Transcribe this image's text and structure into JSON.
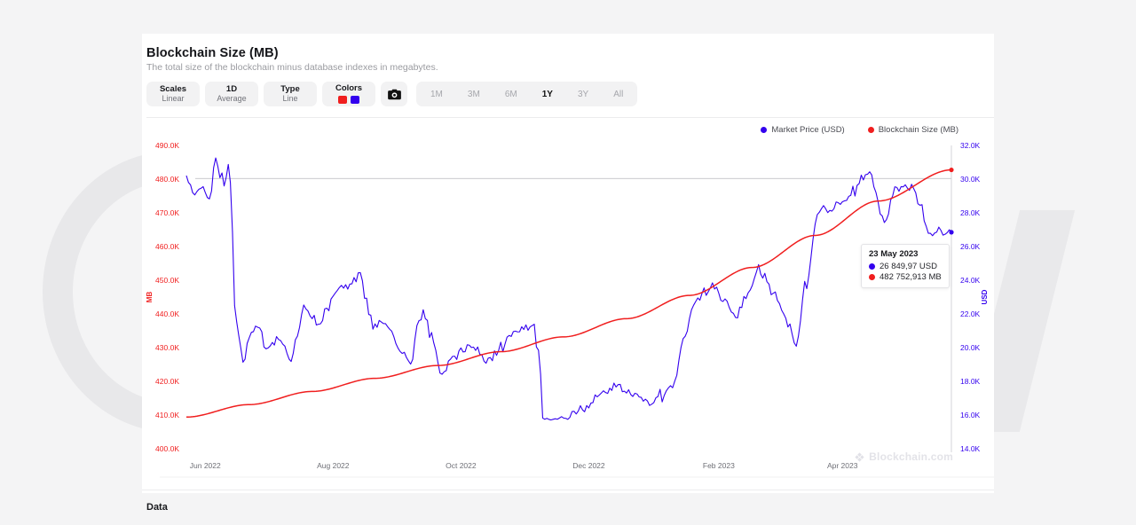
{
  "header": {
    "title": "Blockchain Size (MB)",
    "subtitle": "The total size of the blockchain minus database indexes in megabytes."
  },
  "toolbar": {
    "scales": {
      "label": "Scales",
      "value": "Linear"
    },
    "interval": {
      "label": "1D",
      "value": "Average"
    },
    "type": {
      "label": "Type",
      "value": "Line"
    },
    "colors": {
      "label": "Colors",
      "swatch_1": "#f01e1e",
      "swatch_2": "#3300ee"
    },
    "camera_icon": "camera-icon",
    "ranges": [
      "1M",
      "3M",
      "6M",
      "1Y",
      "3Y",
      "All"
    ],
    "active_range": "1Y"
  },
  "legend": [
    {
      "label": "Market Price (USD)",
      "color": "#3300ee"
    },
    {
      "label": "Blockchain Size (MB)",
      "color": "#f01e1e"
    }
  ],
  "tooltip": {
    "date": "23 May 2023",
    "rows": [
      {
        "value": "26 849,97 USD",
        "color": "#3300ee"
      },
      {
        "value": "482 752,913 MB",
        "color": "#f01e1e"
      }
    ]
  },
  "watermark": {
    "text": "Blockchain.com",
    "icon": "blockchain-logo-icon"
  },
  "footer": {
    "data_label": "Data"
  },
  "chart_data": {
    "type": "line",
    "title": "Blockchain Size (MB)",
    "subtitle": "The total size of the blockchain minus database indexes in megabytes.",
    "xlabel": "",
    "grid": false,
    "legend_position": "top-right",
    "x_tick_labels": [
      "Jun 2022",
      "Aug 2022",
      "Oct 2022",
      "Dec 2022",
      "Feb 2023",
      "Apr 2023"
    ],
    "x_range": [
      "2022-05-23",
      "2023-05-23"
    ],
    "axes": [
      {
        "id": "left",
        "name": "MB",
        "color": "#f01e1e",
        "ylim": [
          400000,
          490000
        ],
        "tick_labels": [
          "490.0K",
          "480.0K",
          "470.0K",
          "460.0K",
          "450.0K",
          "440.0K",
          "430.0K",
          "420.0K",
          "410.0K",
          "400.0K"
        ],
        "tick_values": [
          490000,
          480000,
          470000,
          460000,
          450000,
          440000,
          430000,
          420000,
          410000,
          400000
        ]
      },
      {
        "id": "right",
        "name": "USD",
        "color": "#3300ee",
        "ylim": [
          14000,
          32000
        ],
        "tick_labels": [
          "32.0K",
          "30.0K",
          "28.0K",
          "26.0K",
          "24.0K",
          "22.0K",
          "20.0K",
          "18.0K",
          "16.0K",
          "14.0K"
        ],
        "tick_values": [
          32000,
          30000,
          28000,
          26000,
          24000,
          22000,
          20000,
          18000,
          16000,
          14000
        ]
      }
    ],
    "series": [
      {
        "name": "Blockchain Size (MB)",
        "color": "#f01e1e",
        "axis": "left",
        "unit": "MB",
        "points": [
          {
            "x": "2022-05-23",
            "y": 409400
          },
          {
            "x": "2022-06-22",
            "y": 413100
          },
          {
            "x": "2022-07-22",
            "y": 417000
          },
          {
            "x": "2022-08-21",
            "y": 420900
          },
          {
            "x": "2022-09-20",
            "y": 424700
          },
          {
            "x": "2022-10-20",
            "y": 428800
          },
          {
            "x": "2022-11-19",
            "y": 433200
          },
          {
            "x": "2022-12-19",
            "y": 438600
          },
          {
            "x": "2023-01-18",
            "y": 445500
          },
          {
            "x": "2023-02-17",
            "y": 453800
          },
          {
            "x": "2023-03-19",
            "y": 463300
          },
          {
            "x": "2023-04-18",
            "y": 473500
          },
          {
            "x": "2023-05-23",
            "y": 482753
          }
        ]
      },
      {
        "name": "Market Price (USD)",
        "color": "#3300ee",
        "axis": "right",
        "unit": "USD",
        "final_value": 26849.97,
        "points": [
          {
            "x": "2022-05-23",
            "y": 30200
          },
          {
            "x": "2022-05-27",
            "y": 29050
          },
          {
            "x": "2022-05-31",
            "y": 29400
          },
          {
            "x": "2022-06-03",
            "y": 28700
          },
          {
            "x": "2022-06-06",
            "y": 31300
          },
          {
            "x": "2022-06-08",
            "y": 30200
          },
          {
            "x": "2022-06-09",
            "y": 30400
          },
          {
            "x": "2022-06-10",
            "y": 29600
          },
          {
            "x": "2022-06-12",
            "y": 30900
          },
          {
            "x": "2022-06-13",
            "y": 29900
          },
          {
            "x": "2022-06-15",
            "y": 22200
          },
          {
            "x": "2022-06-18",
            "y": 20100
          },
          {
            "x": "2022-06-19",
            "y": 19100
          },
          {
            "x": "2022-06-22",
            "y": 20600
          },
          {
            "x": "2022-06-26",
            "y": 21200
          },
          {
            "x": "2022-06-30",
            "y": 19900
          },
          {
            "x": "2022-07-06",
            "y": 20500
          },
          {
            "x": "2022-07-12",
            "y": 19300
          },
          {
            "x": "2022-07-18",
            "y": 22400
          },
          {
            "x": "2022-07-26",
            "y": 21200
          },
          {
            "x": "2022-08-01",
            "y": 23200
          },
          {
            "x": "2022-08-10",
            "y": 23900
          },
          {
            "x": "2022-08-14",
            "y": 24400
          },
          {
            "x": "2022-08-20",
            "y": 21200
          },
          {
            "x": "2022-08-26",
            "y": 21400
          },
          {
            "x": "2022-09-07",
            "y": 19000
          },
          {
            "x": "2022-09-13",
            "y": 22400
          },
          {
            "x": "2022-09-21",
            "y": 18500
          },
          {
            "x": "2022-09-27",
            "y": 19300
          },
          {
            "x": "2022-10-05",
            "y": 20200
          },
          {
            "x": "2022-10-13",
            "y": 19100
          },
          {
            "x": "2022-10-26",
            "y": 20800
          },
          {
            "x": "2022-11-05",
            "y": 21300
          },
          {
            "x": "2022-11-08",
            "y": 18500
          },
          {
            "x": "2022-11-09",
            "y": 15900
          },
          {
            "x": "2022-11-21",
            "y": 15800
          },
          {
            "x": "2022-12-05",
            "y": 17100
          },
          {
            "x": "2022-12-15",
            "y": 17800
          },
          {
            "x": "2022-12-30",
            "y": 16600
          },
          {
            "x": "2023-01-11",
            "y": 17900
          },
          {
            "x": "2023-01-20",
            "y": 22700
          },
          {
            "x": "2023-01-29",
            "y": 23700
          },
          {
            "x": "2023-02-10",
            "y": 21800
          },
          {
            "x": "2023-02-20",
            "y": 24800
          },
          {
            "x": "2023-03-03",
            "y": 22300
          },
          {
            "x": "2023-03-10",
            "y": 20100
          },
          {
            "x": "2023-03-20",
            "y": 28100
          },
          {
            "x": "2023-03-31",
            "y": 28500
          },
          {
            "x": "2023-04-14",
            "y": 30500
          },
          {
            "x": "2023-04-21",
            "y": 27300
          },
          {
            "x": "2023-04-26",
            "y": 29500
          },
          {
            "x": "2023-05-05",
            "y": 29500
          },
          {
            "x": "2023-05-12",
            "y": 26800
          },
          {
            "x": "2023-05-23",
            "y": 26850
          }
        ]
      }
    ],
    "crosshair": {
      "y_value_left": 480200,
      "style": "horizontal-gray-line"
    }
  }
}
